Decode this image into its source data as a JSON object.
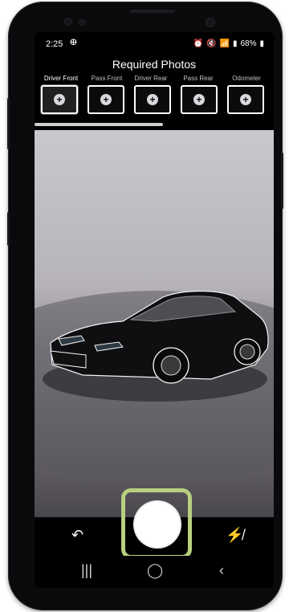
{
  "status": {
    "time": "2:25",
    "left_icon": "sync-icon",
    "right_text": "68%",
    "icons": [
      "alarm-icon",
      "mute-icon",
      "wifi-icon",
      "signal-icon",
      "battery-icon"
    ]
  },
  "header": {
    "title": "Required Photos"
  },
  "tabs": [
    {
      "label": "Driver Front",
      "active": true
    },
    {
      "label": "Pass Front",
      "active": false
    },
    {
      "label": "Driver Rear",
      "active": false
    },
    {
      "label": "Pass Rear",
      "active": false
    },
    {
      "label": "Odometer",
      "active": false
    }
  ],
  "thumb_icon": "plus-icon",
  "camera": {
    "overlay": "car-outline"
  },
  "controls": {
    "left": "undo-icon",
    "right": "flash-off-icon",
    "center": "shutter-button"
  },
  "navbar": {
    "items": [
      "recent-apps-icon",
      "home-icon",
      "back-icon"
    ]
  },
  "colors": {
    "highlight": "#b8d080",
    "status_text": "#ffffff"
  }
}
